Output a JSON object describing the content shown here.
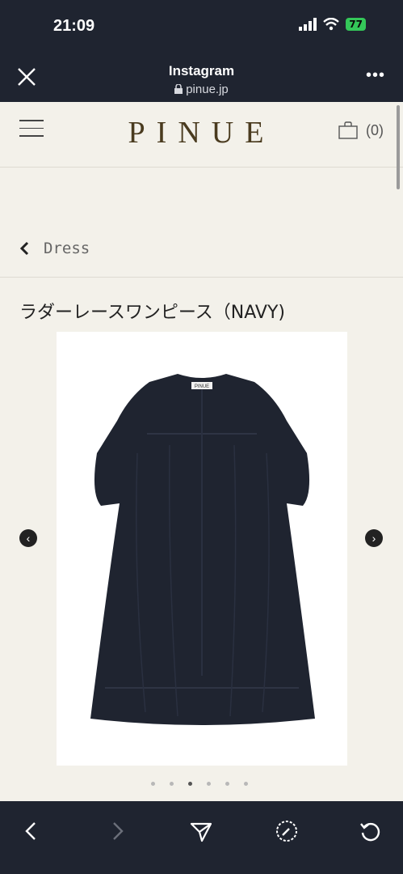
{
  "status": {
    "time": "21:09",
    "battery": "77"
  },
  "browser": {
    "title": "Instagram",
    "domain": "pinue.jp"
  },
  "site": {
    "logo": "PINUE",
    "cart_count": "(0)"
  },
  "breadcrumb": {
    "label": "Dress"
  },
  "product": {
    "title": "ラダーレースワンピース（NAVY)",
    "image_logo": "PINUE"
  },
  "carousel": {
    "dot_count": 6,
    "active_index": 2
  },
  "colors": {
    "chrome": "#1f2430",
    "page_bg": "#f3f1ea",
    "logo": "#4a3b1f",
    "dress": "#1f2430",
    "battery": "#34c759"
  },
  "icons": [
    "close-icon",
    "lock-icon",
    "more-icon",
    "menu-icon",
    "bag-icon",
    "chevron-left-icon",
    "arrow-left-icon",
    "arrow-right-icon",
    "back-icon",
    "forward-icon",
    "share-icon",
    "safari-icon",
    "reload-icon"
  ]
}
